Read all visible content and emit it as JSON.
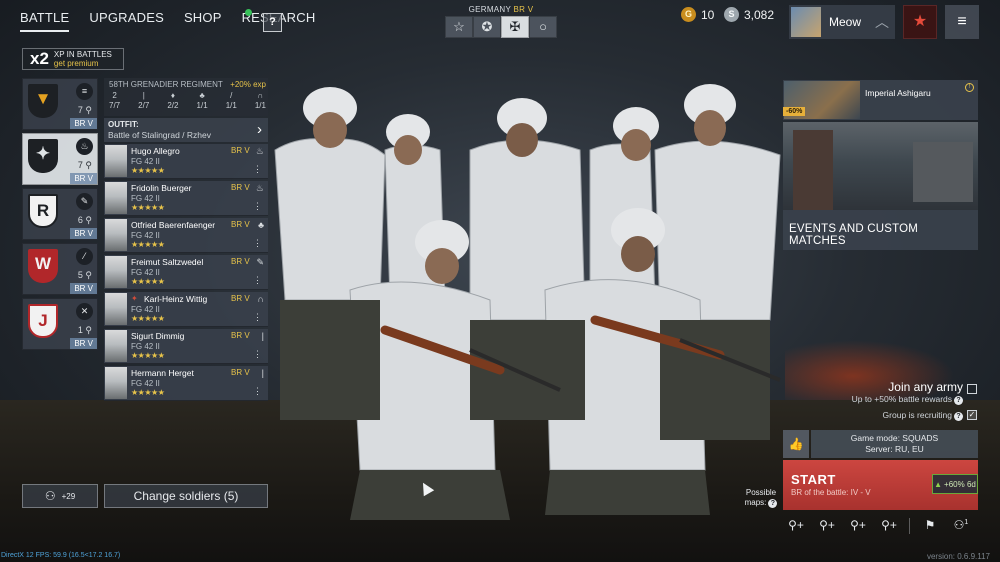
{
  "nav": {
    "battle": "BATTLE",
    "upgrades": "UPGRADES",
    "shop": "SHOP",
    "research": "RESEARCH",
    "help": "?"
  },
  "nation": {
    "name": "GERMANY",
    "br": "BR V"
  },
  "army_tabs": [
    "star-outline-icon",
    "star-circle-icon",
    "iron-cross-icon",
    "circle-icon"
  ],
  "currency": {
    "gold": "10",
    "silver": "3,082"
  },
  "profile": {
    "name": "Meow"
  },
  "xp_promo": {
    "multiplier": "x2",
    "label": "XP IN BATTLES",
    "cta": "get premium"
  },
  "squads": [
    {
      "count": "7",
      "br": "BR V",
      "emblem": "eagle-icon",
      "mark": ""
    },
    {
      "count": "7",
      "br": "BR V",
      "emblem": "bird-icon",
      "mark": ""
    },
    {
      "count": "6",
      "br": "BR V",
      "emblem": "R",
      "mark": ""
    },
    {
      "count": "5",
      "br": "BR V",
      "emblem": "W",
      "mark": ""
    },
    {
      "count": "1",
      "br": "BR V",
      "emblem": "J",
      "mark": ""
    }
  ],
  "regiment": {
    "name": "58TH GRENADIER REGIMENT",
    "bonus": "+20% exp",
    "stats": [
      {
        "icon": "2",
        "value": "7/7"
      },
      {
        "icon": "|",
        "value": "2/7"
      },
      {
        "icon": "♦",
        "value": "2/2"
      },
      {
        "icon": "♣",
        "value": "1/1"
      },
      {
        "icon": "/",
        "value": "1/1"
      },
      {
        "icon": "∩",
        "value": "1/1"
      }
    ]
  },
  "outfit": {
    "label": "OUTFIT:",
    "value": "Battle of Stalingrad / Rzhev"
  },
  "soldiers": [
    {
      "name": "Hugo Allegro",
      "weapon": "FG 42 II",
      "br": "BR V",
      "stars": "★★★★★"
    },
    {
      "name": "Fridolin Buerger",
      "weapon": "FG 42 II",
      "br": "BR V",
      "stars": "★★★★★"
    },
    {
      "name": "Otfried Baerenfaenger",
      "weapon": "FG 42 II",
      "br": "BR V",
      "stars": "★★★★★"
    },
    {
      "name": "Freimut Saltzwedel",
      "weapon": "FG 42 II",
      "br": "BR V",
      "stars": "★★★★★"
    },
    {
      "name": "Karl-Heinz Wittig",
      "weapon": "FG 42 II",
      "br": "BR V",
      "stars": "★★★★★"
    },
    {
      "name": "Sigurt Dimmig",
      "weapon": "FG 42 II",
      "br": "BR V",
      "stars": "★★★★★"
    },
    {
      "name": "Hermann Herget",
      "weapon": "FG 42 II",
      "br": "BR V",
      "stars": "★★★★★"
    }
  ],
  "squad_invite": {
    "count": "+29"
  },
  "change_soldiers": "Change soldiers (5)",
  "fps": "DirectX 12 FPS: 59.9 (16.5<17.2 16.7)",
  "version": "version: 0.6.9.117",
  "event": {
    "name": "Imperial Ashigaru",
    "discount": "-60%"
  },
  "events_label": "EVENTS AND CUSTOM MATCHES",
  "join_any_army": "Join any army",
  "join_sub": "Up to +50% battle rewards",
  "group_recruiting": "Group is recruiting",
  "game_mode": "Game mode: SQUADS",
  "server": "Server: RU, EU",
  "start": {
    "label": "START",
    "sub": "BR of the battle: IV - V"
  },
  "xp_boost": "+60% 6d",
  "possible_maps": "Possible maps:",
  "bottom_icons": [
    "add-friend-icon",
    "add-friend-icon",
    "add-friend-icon",
    "add-friend-icon",
    "flag-icon",
    "group-icon"
  ],
  "group_count": "1"
}
